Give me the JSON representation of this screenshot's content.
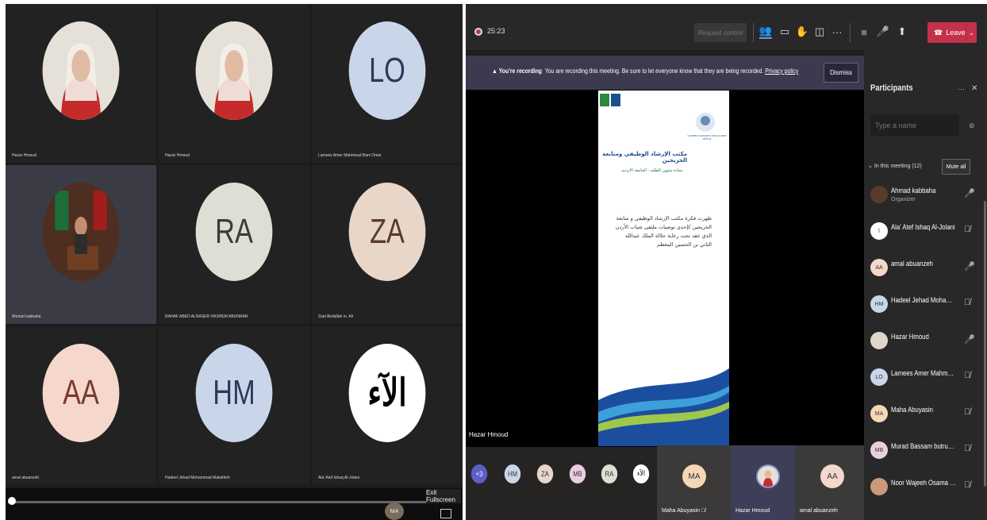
{
  "gallery": {
    "tiles": [
      {
        "name": "Hazar Hmoud",
        "initials": "",
        "bg": "#dfd6c8"
      },
      {
        "name": "Hazar Hmoud",
        "initials": "",
        "bg": "#dfd6c8"
      },
      {
        "name": "Lamees Amer Mahmoud Bani Omar",
        "initials": "LO",
        "bg": "#c9d6ea"
      },
      {
        "name": "Ahmad kabbaha",
        "initials": "",
        "bg": "#5a3a2a"
      },
      {
        "name": "RAHAF ABED ALNASER HASHEM ABUNNAR",
        "initials": "RA",
        "bg": "#dcdfd3"
      },
      {
        "name": "Zaid Abdallah m. Ali",
        "initials": "ZA",
        "bg": "#e8d6c9"
      },
      {
        "name": "amal abuanzeh",
        "initials": "AA",
        "bg": "#f5d7cc"
      },
      {
        "name": "Hadeel Jehad Mohammad Makahleh",
        "initials": "HM",
        "bg": "#c9d6ea"
      },
      {
        "name": "Ala' Atef Ishaq Al-Jolani",
        "initials": "الآء",
        "bg": "#ffffff"
      }
    ],
    "exit_fullscreen": "Exit Fullscreen",
    "mini_initials": "MA"
  },
  "toolbar": {
    "timer": "25:23",
    "request_control": "Request control",
    "leave": "Leave"
  },
  "banner": {
    "title": "You're recording",
    "message": "You are recording this meeting. Be sure to let everyone know that they are being recorded.",
    "link": "Privacy policy",
    "dismiss": "Dismiss"
  },
  "slide": {
    "heading": "مكتب الإرشاد الوظيفي ومتابعة الخريجين",
    "subheading": "عمادة شؤون الطلبة - الجامعة الأردنية",
    "body": "ظهرت فكرة مكتب الإرشاد الوظيفي و متابعة الخريجين كإحدى توصيات ملتقى شباب الأردن الذي عقد تحت رعاية جلالة الملك عبدالله الثاني بن الحسين المعظم",
    "logo_text": "CAREER GUIDANCE AND ALUMNI OFFICE"
  },
  "presenter": "Hazar Hmoud",
  "strip": {
    "more": "+3",
    "avatars": [
      {
        "initials": "HM",
        "bg": "#c9d6ea"
      },
      {
        "initials": "ZA",
        "bg": "#e8d6c9"
      },
      {
        "initials": "MB",
        "bg": "#e9cfe0"
      },
      {
        "initials": "RA",
        "bg": "#dcdfd3"
      },
      {
        "initials": "الآء",
        "bg": "#ffffff"
      }
    ],
    "videos": [
      {
        "initials": "MA",
        "name": "Maha Abuyasin",
        "bg": "#f5d7b5"
      },
      {
        "initials": "",
        "name": "Hazar Hmoud",
        "bg": "#dfd6c8"
      },
      {
        "initials": "AA",
        "name": "amal abuanzeh",
        "bg": "#f5d7cc"
      }
    ]
  },
  "participants": {
    "title": "Participants",
    "search_placeholder": "Type a name",
    "in_meeting": "In this meeting (12)",
    "mute_all": "Mute all",
    "list": [
      {
        "name": "Ahmad kabbaha",
        "role": "Organizer",
        "initials": "",
        "bg": "#5a3a2a",
        "mic": "on"
      },
      {
        "name": "Ala' Atef Ishaq Al-Jolani",
        "role": "",
        "initials": "ا",
        "bg": "#ffffff",
        "mic": "off"
      },
      {
        "name": "amal abuanzeh",
        "role": "",
        "initials": "AA",
        "bg": "#f5d7cc",
        "mic": "on"
      },
      {
        "name": "Hadeel Jehad Mohammad M...",
        "role": "",
        "initials": "HM",
        "bg": "#c9d6ea",
        "mic": "off"
      },
      {
        "name": "Hazar Hmoud",
        "role": "",
        "initials": "",
        "bg": "#dfd6c8",
        "mic": "on"
      },
      {
        "name": "Lamees Amer Mahmoud Bani...",
        "role": "",
        "initials": "LO",
        "bg": "#c9d6ea",
        "mic": "off"
      },
      {
        "name": "Maha Abuyasin",
        "role": "",
        "initials": "MA",
        "bg": "#f5d7b5",
        "mic": "off"
      },
      {
        "name": "Murad Bassam butrus butrus",
        "role": "",
        "initials": "MB",
        "bg": "#e9cfe0",
        "mic": "off"
      },
      {
        "name": "Noor Wajeeh Osama qadan",
        "role": "",
        "initials": "",
        "bg": "#c99a7a",
        "mic": "off"
      }
    ]
  }
}
